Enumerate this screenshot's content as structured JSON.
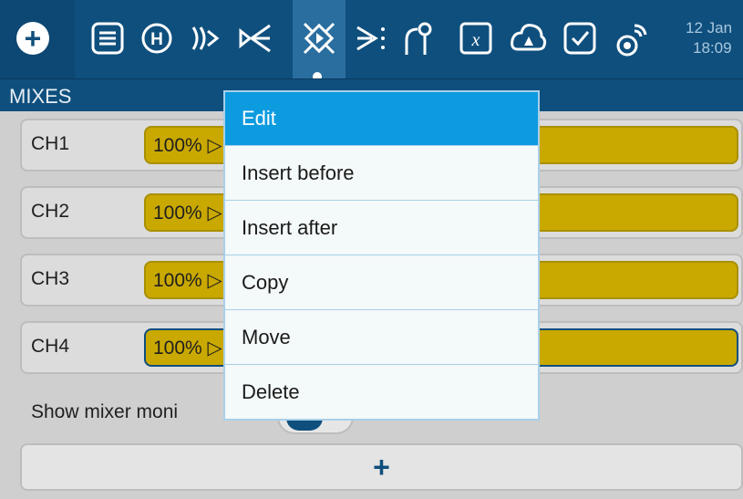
{
  "header": {
    "date": "12 Jan",
    "time": "18:09",
    "active_tab": "mixes"
  },
  "tabs": [
    {
      "icon": "menu-circle-plus-icon"
    },
    {
      "icon": "model-list-icon"
    },
    {
      "icon": "heli-icon"
    },
    {
      "icon": "flight-modes-icon"
    },
    {
      "icon": "inputs-icon"
    },
    {
      "icon": "mixes-icon"
    },
    {
      "icon": "outputs-icon"
    },
    {
      "icon": "curves-icon"
    },
    {
      "icon": "global-vars-icon"
    },
    {
      "icon": "logical-switches-icon"
    },
    {
      "icon": "special-functions-icon"
    },
    {
      "icon": "telemetry-icon"
    }
  ],
  "section": {
    "title": "MIXES"
  },
  "mixes": [
    {
      "channel": "CH1",
      "value": "100% ▷"
    },
    {
      "channel": "CH2",
      "value": "100% ▷"
    },
    {
      "channel": "CH3",
      "value": "100% ▷"
    },
    {
      "channel": "CH4",
      "value": "100% ▷"
    }
  ],
  "show_monitor": {
    "label": "Show mixer moni",
    "enabled": true
  },
  "add_button": {
    "label": "+"
  },
  "popup_menu": {
    "items": [
      {
        "label": "Edit",
        "selected": true
      },
      {
        "label": "Insert before"
      },
      {
        "label": "Insert after"
      },
      {
        "label": "Copy"
      },
      {
        "label": "Move"
      },
      {
        "label": "Delete"
      }
    ]
  },
  "colors": {
    "header": "#0f4f7d",
    "mix_bar": "#c9a800",
    "menu_highlight": "#0d9be0"
  }
}
